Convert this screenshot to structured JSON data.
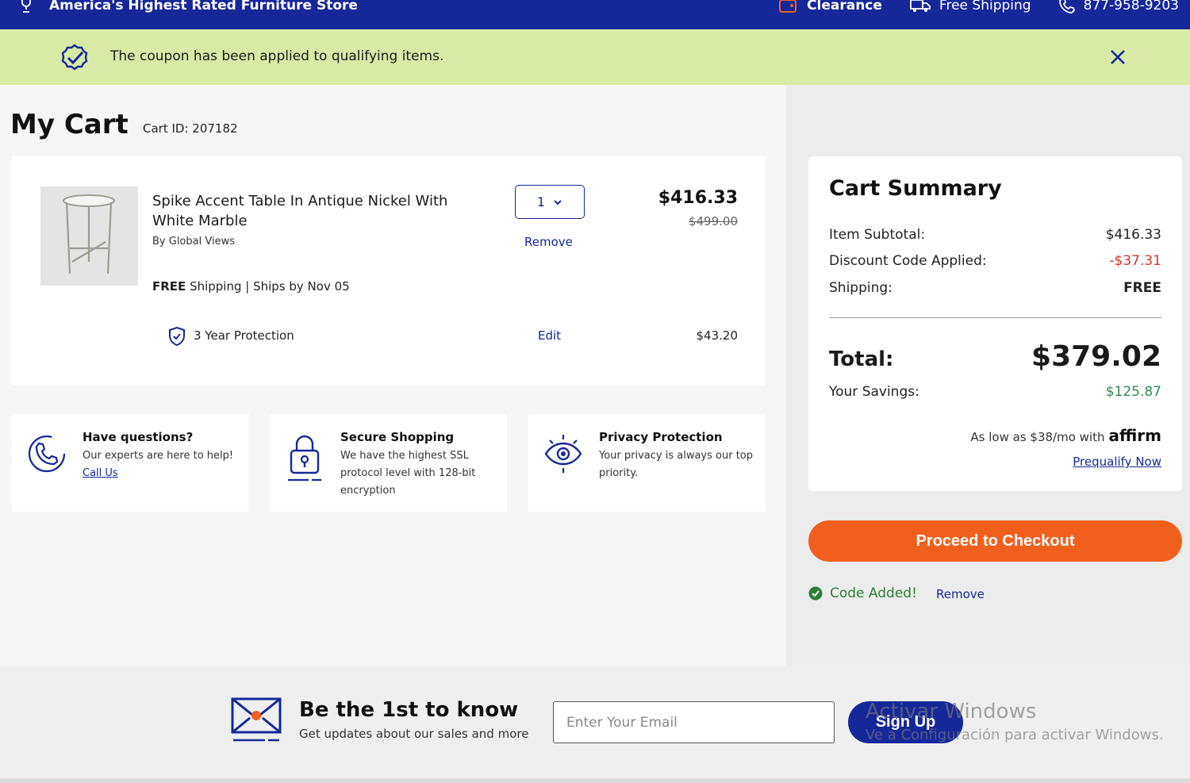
{
  "topbar": {
    "tagline": "America's Highest Rated Furniture Store",
    "clearance": "Clearance",
    "free_shipping": "Free Shipping",
    "phone": "877-958-9203"
  },
  "banner": {
    "message": "The coupon has been applied to qualifying items."
  },
  "cart": {
    "title": "My Cart",
    "cart_id": "Cart ID: 207182",
    "item": {
      "name": "Spike Accent Table In Antique Nickel With White Marble",
      "brand": "By Global Views",
      "ship_free": "FREE",
      "ship_rest": " Shipping | Ships by Nov 05",
      "quantity": "1",
      "remove": "Remove",
      "price": "$416.33",
      "original_price": "$499.00",
      "protection": "3 Year Protection",
      "edit": "Edit",
      "protection_price": "$43.20"
    }
  },
  "info_cards": [
    {
      "title": "Have questions?",
      "text": "Our experts are here to help!",
      "link": "Call Us"
    },
    {
      "title": "Secure Shopping",
      "text": "We have the highest SSL protocol level with 128-bit encryption"
    },
    {
      "title": "Privacy Protection",
      "text": "Your privacy is always our top priority."
    }
  ],
  "summary": {
    "title": "Cart Summary",
    "subtotal_label": "Item Subtotal:",
    "subtotal": "$416.33",
    "discount_label": "Discount Code Applied:",
    "discount": "-$37.31",
    "shipping_label": "Shipping:",
    "shipping": "FREE",
    "total_label": "Total:",
    "total": "$379.02",
    "savings_label": "Your Savings:",
    "savings": "$125.87",
    "affirm_text": "As low as $38/mo with",
    "affirm_logo": "affirm",
    "prequalify": "Prequalify Now"
  },
  "checkout": {
    "button": "Proceed to Checkout",
    "code_added": "Code Added!",
    "code_remove": "Remove"
  },
  "footer": {
    "title": "Be the 1st to know",
    "subtitle": "Get updates about our sales and more",
    "email_placeholder": "Enter Your Email",
    "signup": "Sign Up"
  },
  "watermark": {
    "line1": "Activar Windows",
    "line2": "Ve a Configuración para activar Windows."
  },
  "colors": {
    "brand_blue": "#15289a",
    "banner_green": "#d8eaa6",
    "checkout_orange": "#f0601c",
    "discount_red": "#d6352d",
    "savings_green": "#2e8b57"
  }
}
